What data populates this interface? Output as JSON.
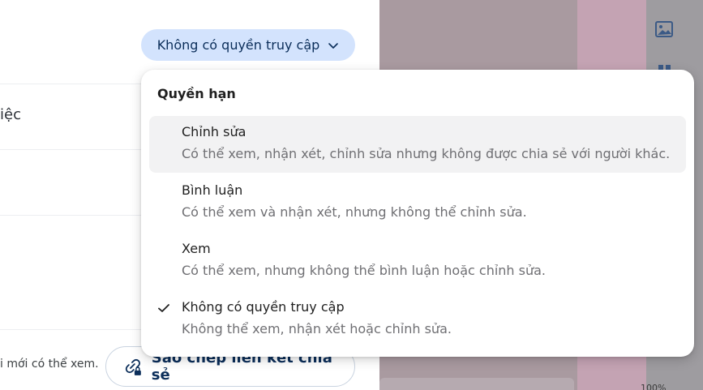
{
  "share_panel": {
    "access_button_label": "Không có quyền truy cập",
    "row_partial_text": "iệc",
    "footer_partial_text": "i mới có thể xem.",
    "copy_link_label": "Sao chép liên kết chia sẻ"
  },
  "permission_menu": {
    "title": "Quyền hạn",
    "items": [
      {
        "label": "Chỉnh sửa",
        "description": "Có thể xem, nhận xét, chỉnh sửa nhưng không được chia sẻ với người khác.",
        "selected": false
      },
      {
        "label": "Bình luận",
        "description": "Có thể xem và nhận xét, nhưng không thể chỉnh sửa.",
        "selected": false
      },
      {
        "label": "Xem",
        "description": "Có thể xem, nhưng không thể bình luận hoặc chỉnh sửa.",
        "selected": false
      },
      {
        "label": "Không có quyền truy cập",
        "description": "Không thể xem, nhận xét hoặc chỉnh sửa.",
        "selected": true
      }
    ]
  },
  "background": {
    "zoom_partial": "100%"
  },
  "icons": {
    "access_chevron": "chevron-down-icon",
    "check": "check-icon",
    "copy_link": "link-lock-icon",
    "image": "image-icon"
  },
  "colors": {
    "accent_pill": "#d3e3fd",
    "accent_text": "#0b2e5a",
    "hover_row": "#f2f2f3"
  }
}
